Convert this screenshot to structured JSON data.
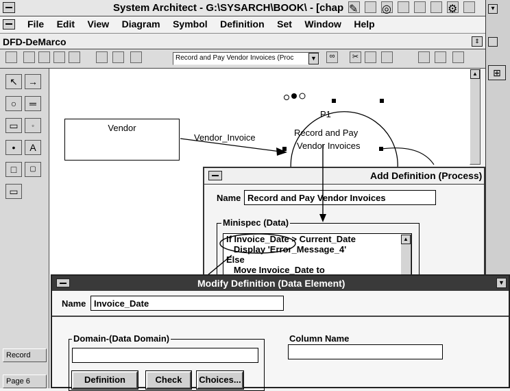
{
  "app": {
    "title": "System Architect - G:\\SYSARCH\\BOOK\\ - [chap",
    "doc_title": "DFD-DeMarco"
  },
  "menu": [
    {
      "label": "File"
    },
    {
      "label": "Edit"
    },
    {
      "label": "View"
    },
    {
      "label": "Diagram"
    },
    {
      "label": "Symbol"
    },
    {
      "label": "Definition"
    },
    {
      "label": "Set"
    },
    {
      "label": "Window"
    },
    {
      "label": "Help"
    }
  ],
  "toolbar": {
    "combo_value": "Record and Pay Vendor Invoices (Proc"
  },
  "diagram": {
    "entity_vendor": "Vendor",
    "flow_label": "Vendor_Invoice",
    "process_id": "P1",
    "process_name_line1": "Record and Pay",
    "process_name_line2": "Vendor Invoices"
  },
  "status": {
    "record": "Record",
    "page": "Page 6"
  },
  "add_definition": {
    "title": "Add  Definition (Process)",
    "name_label": "Name",
    "name_value": "Record and Pay Vendor Invoices",
    "minispec_label": "Minispec (Data)",
    "minispec_lines": [
      "If Invoice_Date > Current_Date",
      "   Display 'Error_Message_4'",
      "Else",
      "   Move Invoice_Date to"
    ]
  },
  "modify_definition": {
    "title": "Modify  Definition (Data Element)",
    "name_label": "Name",
    "name_value": "Invoice_Date",
    "domain_label": "Domain-(Data Domain)",
    "domain_value": "",
    "column_label": "Column Name",
    "column_value": "",
    "btn_definition": "Definition",
    "btn_check": "Check",
    "btn_choices": "Choices..."
  }
}
